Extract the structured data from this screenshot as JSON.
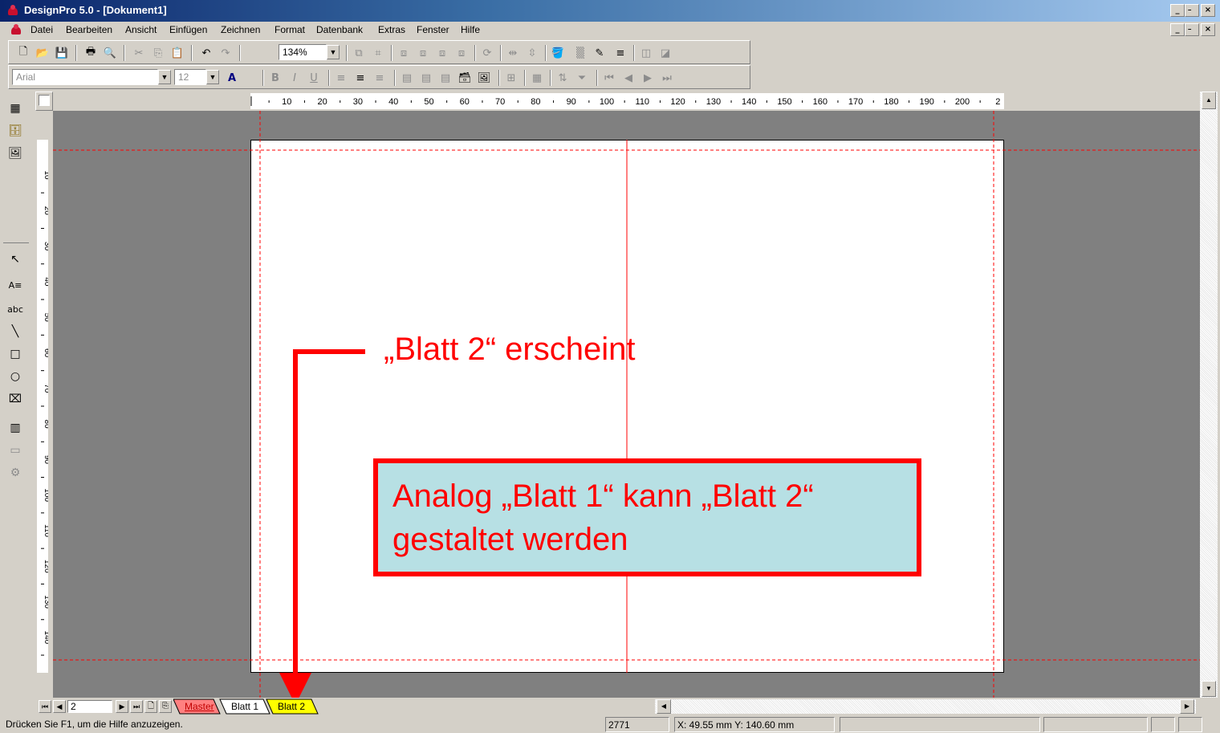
{
  "window": {
    "title": "DesignPro 5.0 - [Dokument1]",
    "caption_minimize": "_",
    "caption_restore": "̵",
    "caption_close": "×"
  },
  "menu": {
    "items": [
      "Datei",
      "Bearbeiten",
      "Ansicht",
      "Einfügen",
      "Zeichnen",
      "Format",
      "Datenbank",
      "Extras",
      "Fenster",
      "Hilfe"
    ]
  },
  "toolbar": {
    "zoom_value": "134%",
    "font_name": "Arial",
    "font_size": "12"
  },
  "ruler": {
    "top_ticks": [
      "10",
      "20",
      "30",
      "40",
      "50",
      "60",
      "70",
      "80",
      "90",
      "100",
      "110",
      "120",
      "130",
      "140",
      "150",
      "160",
      "170",
      "180",
      "190",
      "200",
      "2"
    ],
    "left_ticks": [
      "10",
      "20",
      "30",
      "40",
      "50",
      "60",
      "70",
      "80",
      "90",
      "100",
      "110",
      "120",
      "130",
      "140"
    ]
  },
  "sheet_nav": {
    "page_number": "2",
    "tabs": [
      {
        "label": "Master",
        "color": "#ff8080"
      },
      {
        "label": "Blatt 1",
        "color": "#ffffff"
      },
      {
        "label": "Blatt 2",
        "color": "#ffff00"
      }
    ]
  },
  "statusbar": {
    "help_text": "Drücken Sie F1, um die Hilfe anzuzeigen.",
    "count": "2771",
    "coordinates": "X: 49.55 mm  Y: 140.60 mm"
  },
  "annotations": {
    "arrow_label": "„Blatt 2“ erscheint",
    "callout_text": "Analog „Blatt 1“ kann „Blatt 2“ gestaltet werden"
  },
  "colors": {
    "annotation_red": "#ff0000",
    "callout_bg": "#b7e0e4",
    "workspace_gray": "#808080",
    "titlebar_blue": "#0a246a"
  }
}
